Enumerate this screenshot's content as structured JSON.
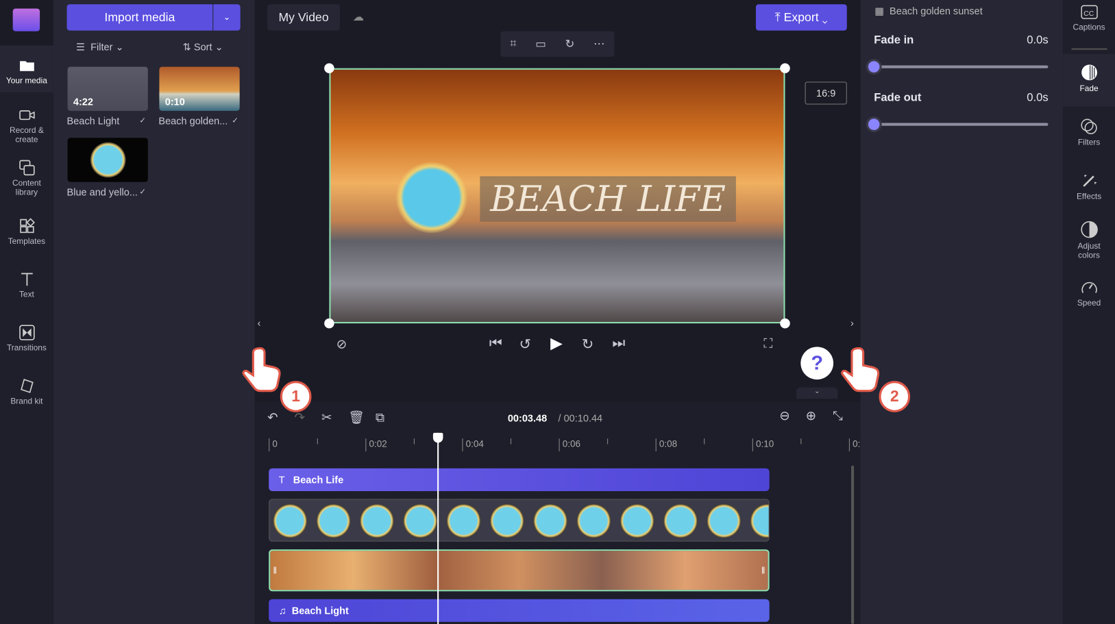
{
  "app": {
    "project_name": "My Video",
    "export_label": "Export",
    "aspect_ratio": "16:9",
    "accent": "#5b4fe0"
  },
  "nav": {
    "items": [
      {
        "label": "Your media",
        "icon": "folder-icon"
      },
      {
        "label": "Record & create",
        "icon": "camera-icon"
      },
      {
        "label": "Content library",
        "icon": "library-icon"
      },
      {
        "label": "Templates",
        "icon": "templates-icon"
      },
      {
        "label": "Text",
        "icon": "text-icon"
      },
      {
        "label": "Transitions",
        "icon": "transitions-icon"
      },
      {
        "label": "Brand kit",
        "icon": "brand-kit-icon"
      }
    ]
  },
  "media": {
    "import_label": "Import media",
    "filter_label": "Filter",
    "sort_label": "Sort",
    "items": [
      {
        "name": "Beach Light",
        "duration": "4:22"
      },
      {
        "name": "Beach golden...",
        "duration": "0:10"
      },
      {
        "name": "Blue and yello...",
        "duration": ""
      }
    ]
  },
  "preview": {
    "title_text": "BEACH LIFE"
  },
  "timeline": {
    "current": "00:03.48",
    "total": "/ 00:10.44",
    "separator": "/",
    "ticks": [
      "0",
      "0:02",
      "0:04",
      "0:06",
      "0:08",
      "0:10",
      "0:1"
    ],
    "tracks": {
      "text": "Beach Life",
      "audio": "Beach Light"
    },
    "playhead_seconds": 3.48
  },
  "properties": {
    "clip_name": "Beach golden sunset",
    "fade_in": {
      "label": "Fade in",
      "value": "0.0s",
      "fraction": 0
    },
    "fade_out": {
      "label": "Fade out",
      "value": "0.0s",
      "fraction": 0
    }
  },
  "tools": {
    "items": [
      {
        "label": "Captions",
        "icon": "captions-icon"
      },
      {
        "label": "Fade",
        "icon": "fade-icon"
      },
      {
        "label": "Filters",
        "icon": "filters-icon"
      },
      {
        "label": "Effects",
        "icon": "effects-icon"
      },
      {
        "label": "Adjust colors",
        "icon": "adjust-colors-icon"
      },
      {
        "label": "Speed",
        "icon": "speed-icon"
      }
    ]
  },
  "callouts": [
    "1",
    "2"
  ],
  "help": "?"
}
